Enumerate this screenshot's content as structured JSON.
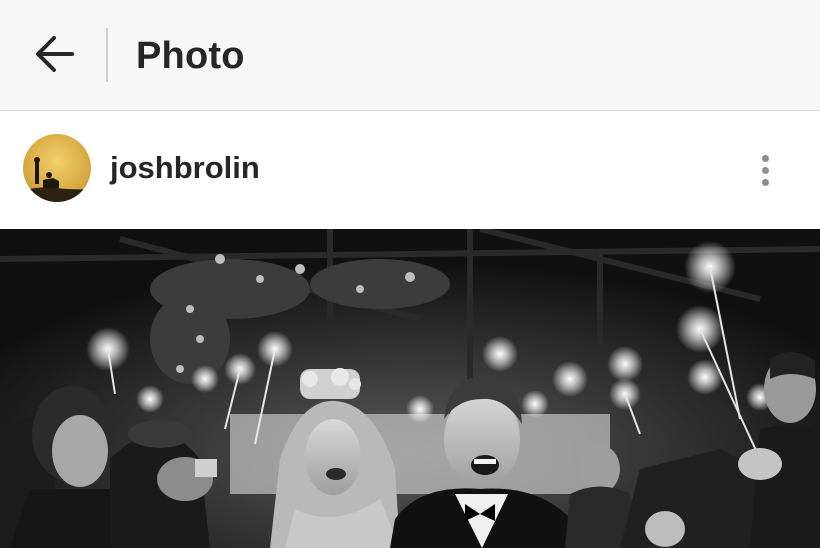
{
  "header": {
    "title": "Photo",
    "back_icon": "arrow-left-icon"
  },
  "post": {
    "username": "joshbrolin",
    "more_icon": "more-vertical-icon",
    "avatar_icon": "profile-avatar",
    "image_description_icon": "photo-wedding-sparklers"
  },
  "colors": {
    "header_bg": "#f7f7f7",
    "text": "#262626",
    "icon_gray": "#8e8e8e"
  }
}
